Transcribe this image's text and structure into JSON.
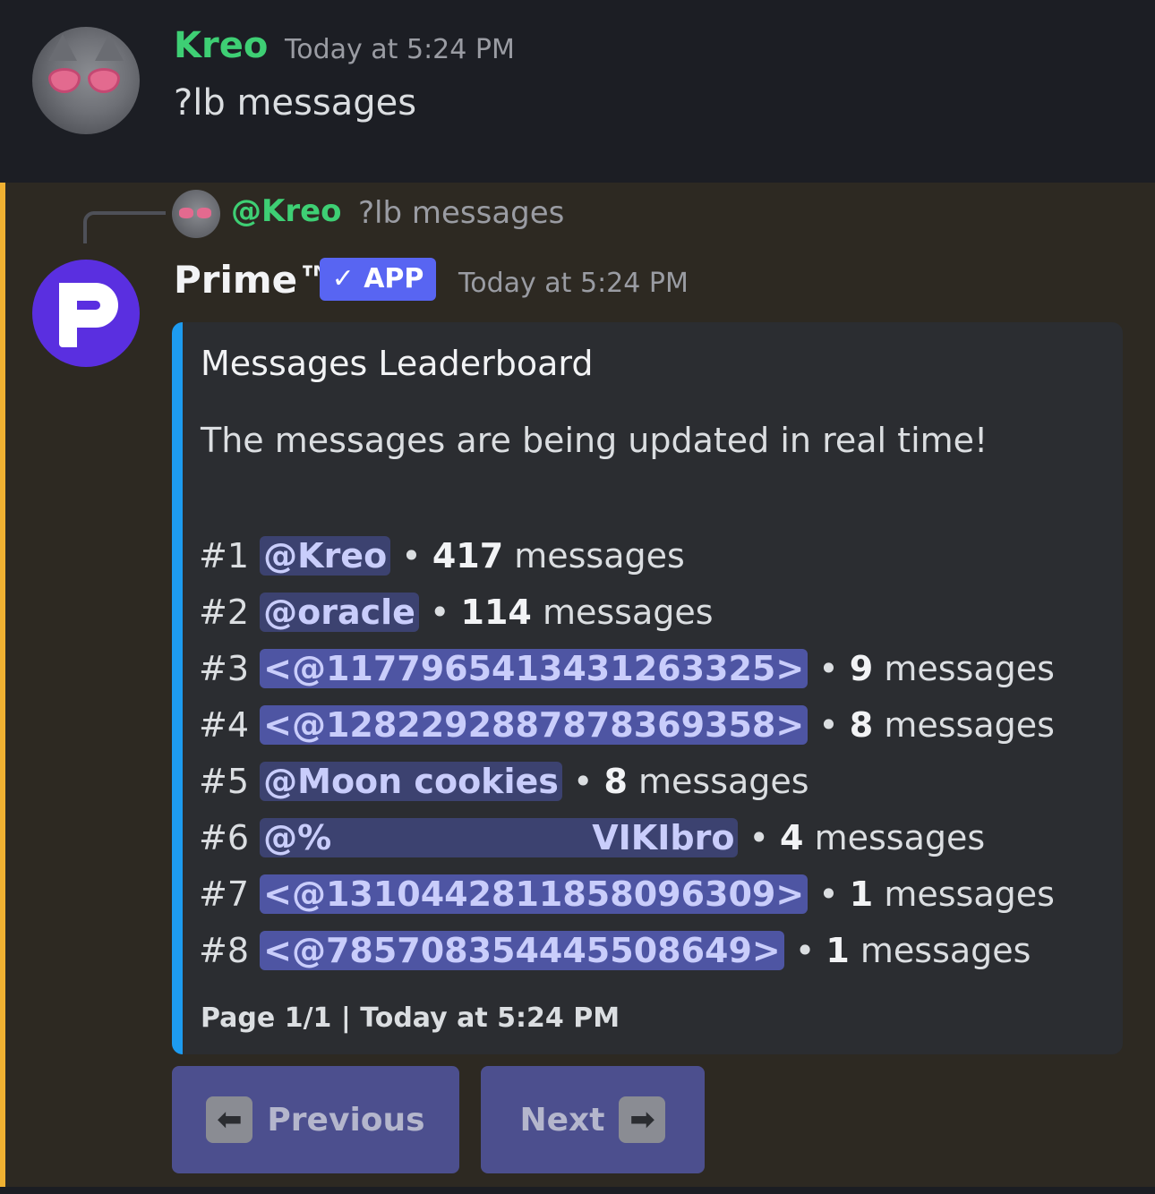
{
  "message1": {
    "author": "Kreo",
    "timestamp": "Today at 5:24 PM",
    "content": "?lb messages"
  },
  "message2": {
    "reply": {
      "author": "@Kreo",
      "content": "?lb messages"
    },
    "author": "Prime™",
    "badge": "✓ APP",
    "timestamp": "Today at 5:24 PM",
    "embed": {
      "title": "Messages Leaderboard",
      "description": "The messages are being updated in real time!",
      "rows": [
        {
          "rank": "#1",
          "mention": "@Kreo",
          "count": "417",
          "unit": "messages"
        },
        {
          "rank": "#2",
          "mention": "@oracle",
          "count": "114",
          "unit": "messages"
        },
        {
          "rank": "#3",
          "mention": "<@1177965413431263325>",
          "count": "9",
          "unit": "messages"
        },
        {
          "rank": "#4",
          "mention": "<@1282292887878369358>",
          "count": "8",
          "unit": "messages"
        },
        {
          "rank": "#5",
          "mention": "@Moon cookies",
          "count": "8",
          "unit": "messages"
        },
        {
          "rank": "#6",
          "mention": "@%                      VIKIbro",
          "count": "4",
          "unit": "messages"
        },
        {
          "rank": "#7",
          "mention": "<@1310442811858096309>",
          "count": "1",
          "unit": "messages"
        },
        {
          "rank": "#8",
          "mention": "<@785708354445508649>",
          "count": "1",
          "unit": "messages"
        }
      ],
      "footer": "Page 1/1 | Today at 5:24 PM",
      "accent_color": "#1d9bf0"
    },
    "buttons": {
      "previous": "Previous",
      "previous_icon": "⬅",
      "next": "Next",
      "next_icon": "➡"
    }
  },
  "colors": {
    "username_green": "#3ecf74",
    "highlight_bar": "#f0b132",
    "app_badge": "#5865f2"
  }
}
